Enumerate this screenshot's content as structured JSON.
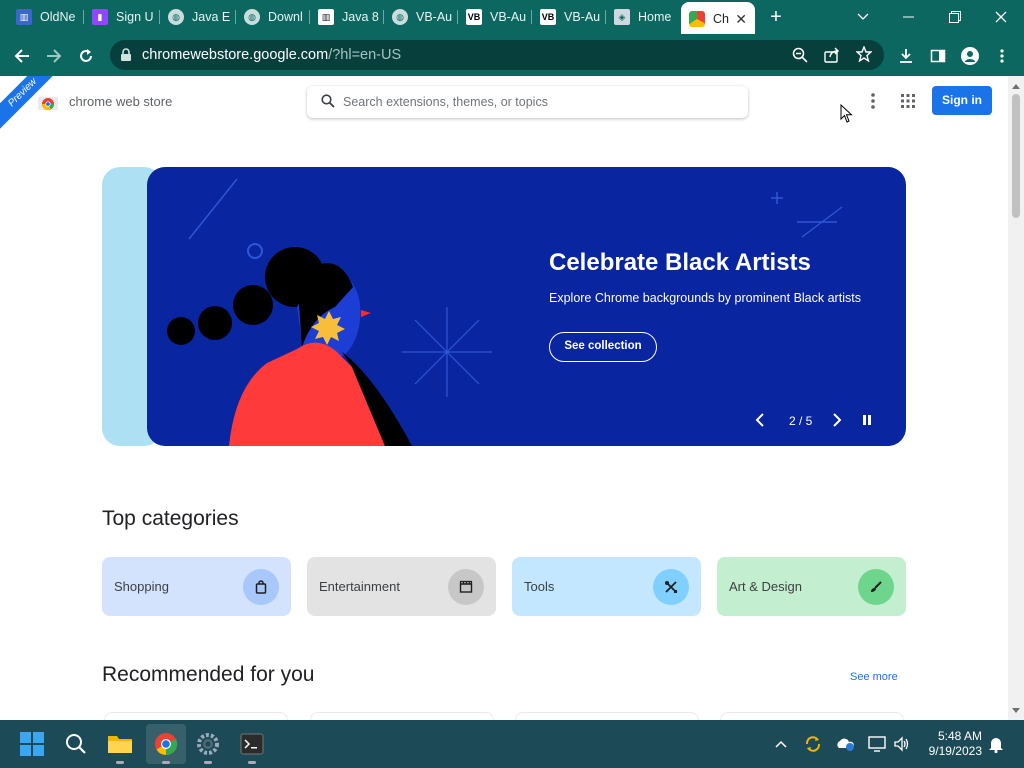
{
  "browser": {
    "tabs": [
      {
        "label": "OldNe",
        "favicon": "library-icon"
      },
      {
        "label": "Sign U",
        "favicon": "twitch-icon"
      },
      {
        "label": "Java E",
        "favicon": "globe-icon"
      },
      {
        "label": "Downl",
        "favicon": "globe-icon"
      },
      {
        "label": "Java 8",
        "favicon": "library-icon"
      },
      {
        "label": "VB-Au",
        "favicon": "globe-icon"
      },
      {
        "label": "VB-Au",
        "favicon": "vb-icon"
      },
      {
        "label": "VB-Au",
        "favicon": "vb-icon"
      },
      {
        "label": "Home",
        "favicon": "page-icon"
      },
      {
        "label": "Ch",
        "favicon": "chrome-webstore-icon",
        "active": true
      }
    ],
    "url_host": "chromewebstore.google.com",
    "url_path": "/?hl=en-US",
    "accent": "#0b6760"
  },
  "header": {
    "ribbon": "Preview",
    "store_name": "chrome web store",
    "search_placeholder": "Search extensions, themes, or topics",
    "signin_label": "Sign in"
  },
  "hero": {
    "title": "Celebrate Black Artists",
    "subtitle": "Explore Chrome backgrounds by prominent Black artists",
    "button": "See collection",
    "counter": "2 / 5",
    "bg": "#0925a0"
  },
  "categories": {
    "heading": "Top categories",
    "items": [
      {
        "label": "Shopping",
        "icon": "shopping-bag-icon",
        "bg": "#d3e3fd",
        "icon_bg": "#a8c7fa"
      },
      {
        "label": "Entertainment",
        "icon": "clapperboard-icon",
        "bg": "#e3e3e3",
        "icon_bg": "#c7c7c7"
      },
      {
        "label": "Tools",
        "icon": "tools-icon",
        "bg": "#c2e7ff",
        "icon_bg": "#7fcfff"
      },
      {
        "label": "Art & Design",
        "icon": "paintbrush-icon",
        "bg": "#c4eed0",
        "icon_bg": "#6dd58c"
      }
    ]
  },
  "recommended": {
    "heading": "Recommended for you",
    "see_more": "See more"
  },
  "taskbar": {
    "time": "5:48 AM",
    "date": "9/19/2023"
  }
}
